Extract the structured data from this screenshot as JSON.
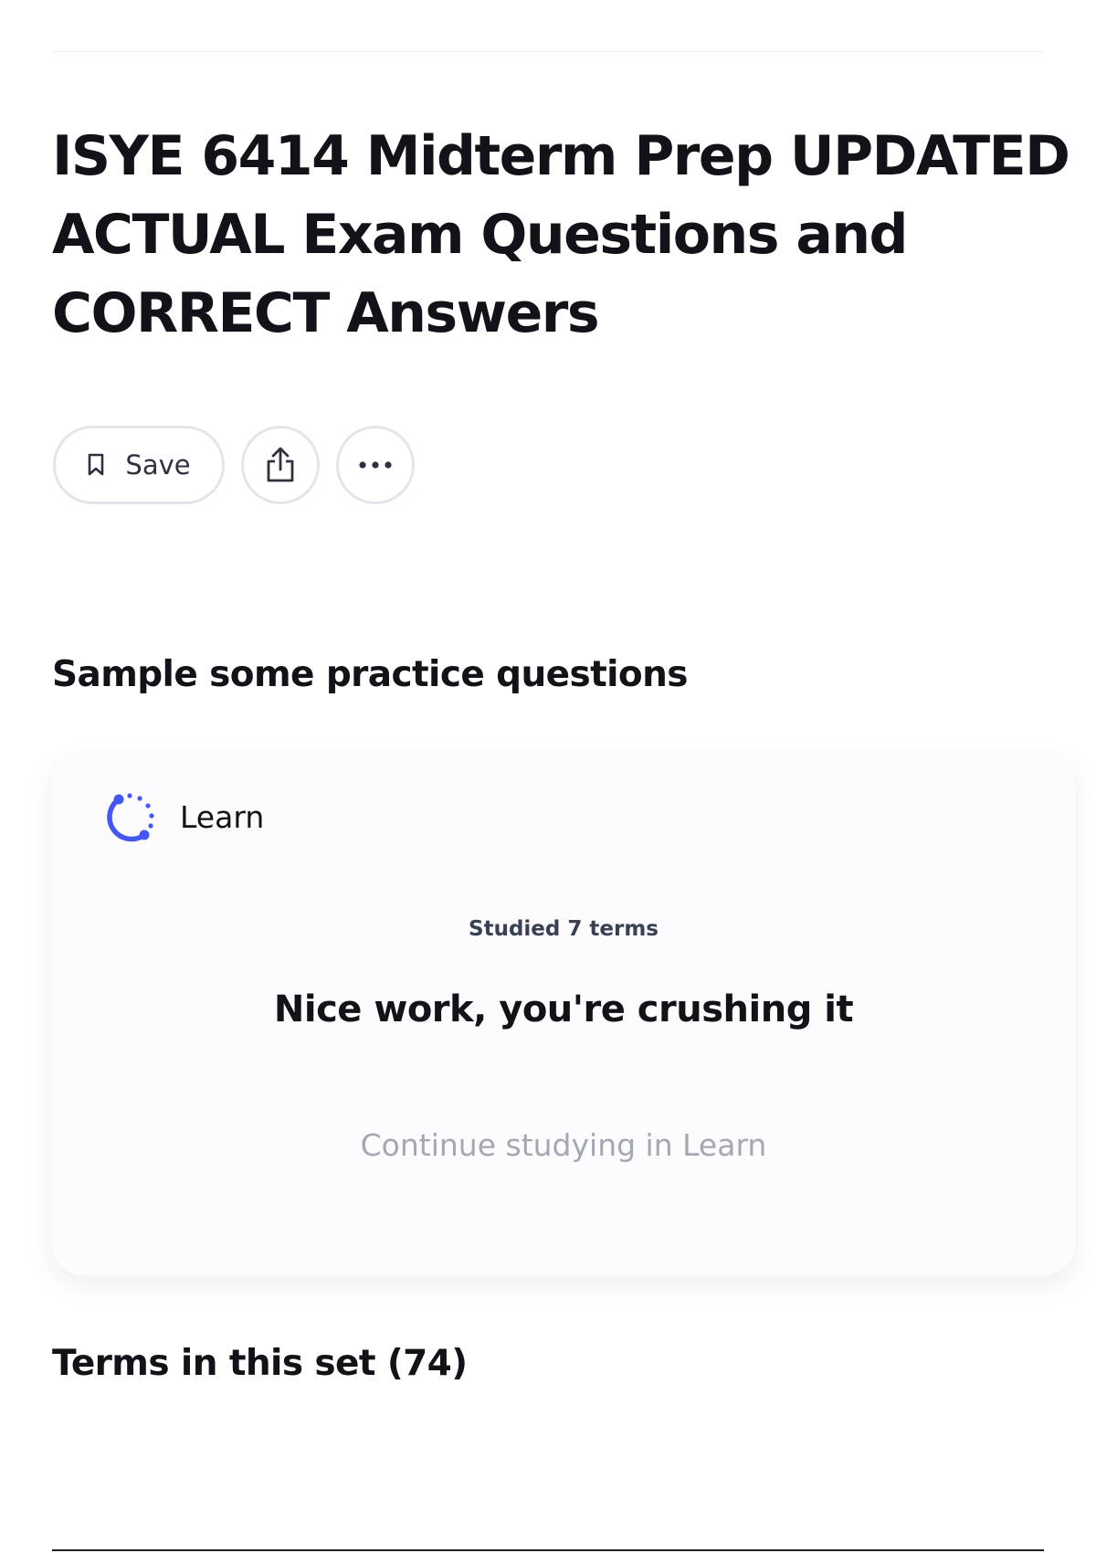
{
  "set": {
    "title": "ISYE 6414 Midterm Prep UPDATED ACTUAL Exam Questions and CORRECT Answers"
  },
  "actions": {
    "save_label": "Save",
    "save_icon": "bookmark-icon",
    "share_icon": "share-icon",
    "more_icon": "more-horizontal-icon"
  },
  "practice": {
    "heading": "Sample some practice questions",
    "mode_label": "Learn",
    "mode_icon": "learn-progress-icon",
    "studied_text": "Studied 7 terms",
    "message": "Nice work, you're crushing it",
    "continue_label": "Continue studying in Learn"
  },
  "terms": {
    "heading": "Terms in this set (74)"
  },
  "colors": {
    "accent": "#4257f5",
    "text_primary": "#111318",
    "text_muted": "#a4a8b2",
    "border": "#e3e5ea"
  }
}
